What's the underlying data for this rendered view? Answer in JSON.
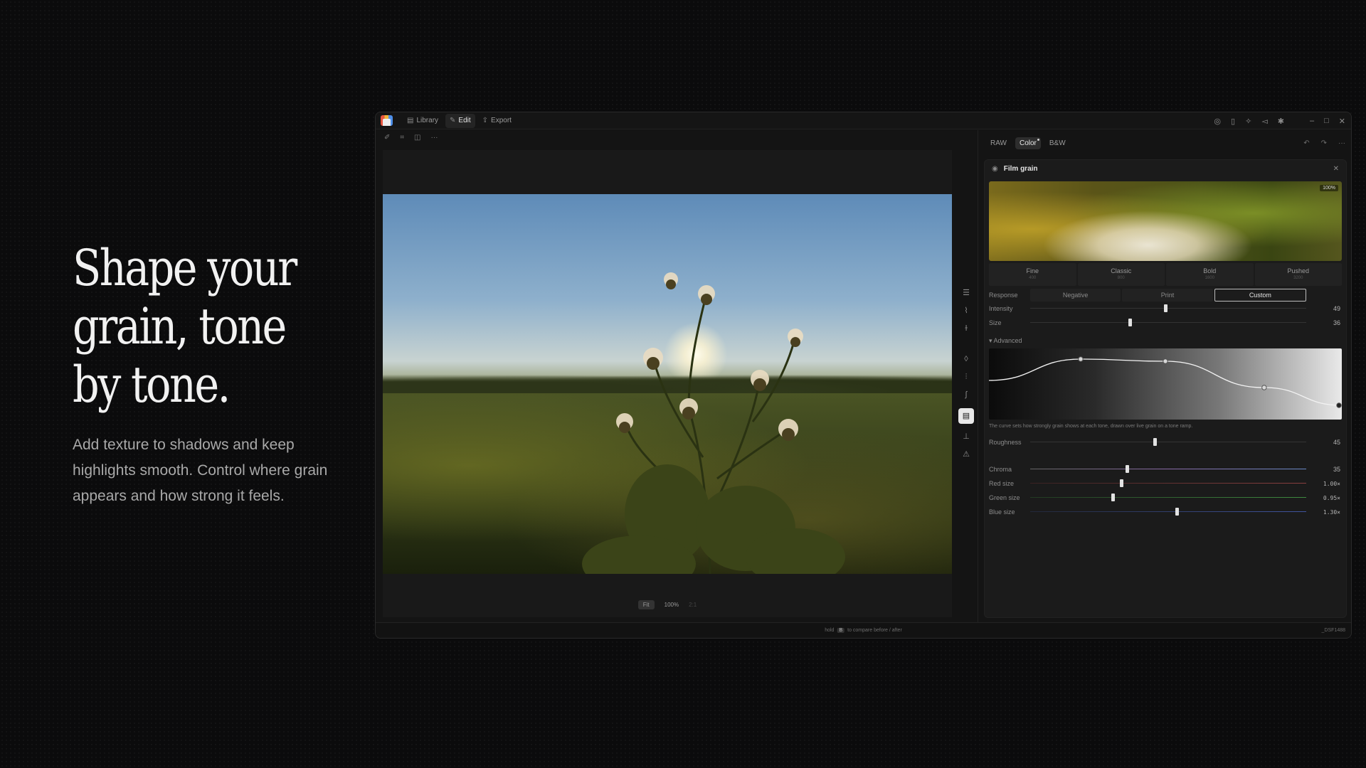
{
  "hero": {
    "title_lines": [
      "Shape your",
      "grain, tone",
      "by tone."
    ],
    "body": "Add texture to shadows and keep highlights smooth. Control where grain appears and how strong it feels."
  },
  "titlebar": {
    "tabs": [
      {
        "label": "Library",
        "icon": "library-icon"
      },
      {
        "label": "Edit",
        "icon": "edit-icon",
        "active": true
      },
      {
        "label": "Export",
        "icon": "export-icon"
      }
    ],
    "right_icons": [
      "globe-icon",
      "book-icon",
      "sparkle-icon",
      "megaphone-icon",
      "gear-icon",
      "minimize-icon",
      "maximize-icon",
      "close-icon"
    ]
  },
  "toolstrip": [
    "pen-icon",
    "crop-icon",
    "compare-icon",
    "more-icon"
  ],
  "canvas": {
    "zoom": {
      "fit": "Fit",
      "current": "100%",
      "other": "2:1"
    }
  },
  "rail_icons": [
    "layers-icon",
    "histogram-icon",
    "temperature-icon",
    "drop-icon",
    "sliders-icon",
    "curve-icon",
    "grain-panel-icon",
    "chart-icon",
    "warning-icon"
  ],
  "panel": {
    "modes": [
      "RAW",
      "Color",
      "B&W"
    ],
    "active_mode": "Color",
    "card_title": "Film grain",
    "preview_zoom": "100%",
    "presets": [
      {
        "name": "Fine",
        "iso": "400"
      },
      {
        "name": "Classic",
        "iso": "800"
      },
      {
        "name": "Bold",
        "iso": "1600"
      },
      {
        "name": "Pushed",
        "iso": "3200"
      }
    ],
    "response": {
      "label": "Response",
      "options": [
        "Negative",
        "Print",
        "Custom"
      ],
      "active": "Custom"
    },
    "intensity": {
      "label": "Intensity",
      "value": "49",
      "level": 0.49
    },
    "size": {
      "label": "Size",
      "value": "36",
      "level": 0.36
    },
    "advanced_label": "▾ Advanced",
    "curve_hint": "The curve sets how strongly grain shows at each tone, drawn over live grain on a tone ramp.",
    "curve_points": [
      [
        0,
        0.55
      ],
      [
        0.26,
        0.85
      ],
      [
        0.5,
        0.82
      ],
      [
        0.78,
        0.45
      ],
      [
        1,
        0.2
      ]
    ],
    "roughness": {
      "label": "Roughness",
      "value": "45",
      "level": 0.45
    },
    "chroma": {
      "label": "Chroma",
      "value": "35",
      "level": 0.35
    },
    "red_size": {
      "label": "Red size",
      "value": "1.00×",
      "level": 0.33
    },
    "green_size": {
      "label": "Green size",
      "value": "0.95×",
      "level": 0.3
    },
    "blue_size": {
      "label": "Blue size",
      "value": "1.30×",
      "level": 0.53
    }
  },
  "statusbar": {
    "hint_pre": "hold",
    "hint_key": "B",
    "hint_post": "to compare before / after",
    "filename": "_DSF1488"
  }
}
